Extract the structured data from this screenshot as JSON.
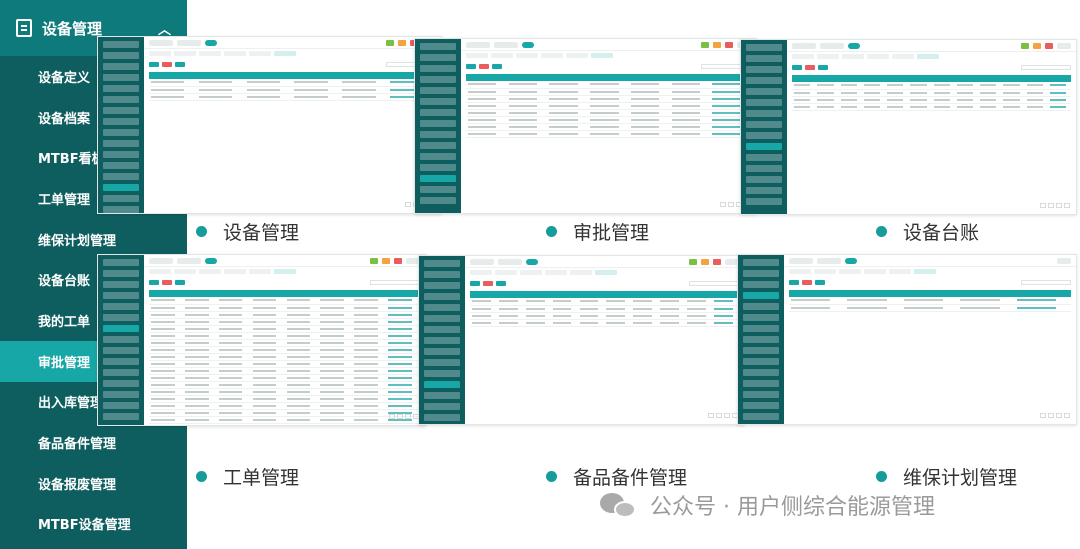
{
  "menu": {
    "header_label": "设备管理",
    "items": [
      {
        "label": "设备定义",
        "active": false
      },
      {
        "label": "设备档案",
        "active": false
      },
      {
        "label": "MTBF看板",
        "active": false
      },
      {
        "label": "工单管理",
        "active": false
      },
      {
        "label": "维保计划管理",
        "active": false
      },
      {
        "label": "设备台账",
        "active": false
      },
      {
        "label": "我的工单",
        "active": false
      },
      {
        "label": "审批管理",
        "active": true
      },
      {
        "label": "出入库管理",
        "active": false
      },
      {
        "label": "备品备件管理",
        "active": false
      },
      {
        "label": "设备报废管理",
        "active": false
      },
      {
        "label": "MTBF设备管理",
        "active": false
      }
    ]
  },
  "screenshots": [
    {
      "caption": "设备管理"
    },
    {
      "caption": "审批管理"
    },
    {
      "caption": "设备台账"
    },
    {
      "caption": "工单管理"
    },
    {
      "caption": "备品备件管理"
    },
    {
      "caption": "维保计划管理"
    }
  ],
  "watermark": {
    "text": "公众号 · 用户侧综合能源管理"
  },
  "colors": {
    "sidebar": "#0e5e60",
    "header": "#0f7a7c",
    "accent": "#17a7a6",
    "caption_dot": "#169c9a"
  }
}
